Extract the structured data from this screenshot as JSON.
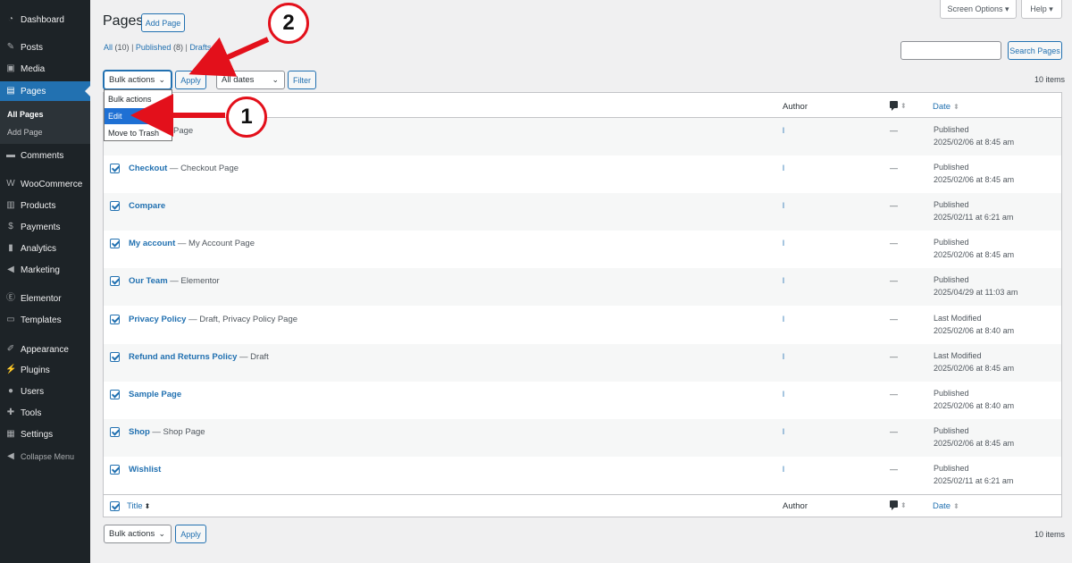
{
  "sidebar": {
    "items": [
      {
        "label": "Dashboard",
        "icon": "dashboard-icon"
      },
      {
        "label": "Posts",
        "icon": "pin-icon"
      },
      {
        "label": "Media",
        "icon": "media-icon"
      },
      {
        "label": "Pages",
        "icon": "page-icon"
      },
      {
        "label": "Comments",
        "icon": "comment-icon"
      },
      {
        "label": "WooCommerce",
        "icon": "woocommerce-icon"
      },
      {
        "label": "Products",
        "icon": "archive-icon"
      },
      {
        "label": "Payments",
        "icon": "dollar-icon"
      },
      {
        "label": "Analytics",
        "icon": "chart-icon"
      },
      {
        "label": "Marketing",
        "icon": "megaphone-icon"
      },
      {
        "label": "Elementor",
        "icon": "elementor-icon"
      },
      {
        "label": "Templates",
        "icon": "folder-icon"
      },
      {
        "label": "Appearance",
        "icon": "brush-icon"
      },
      {
        "label": "Plugins",
        "icon": "plug-icon"
      },
      {
        "label": "Users",
        "icon": "users-icon"
      },
      {
        "label": "Tools",
        "icon": "wrench-icon"
      },
      {
        "label": "Settings",
        "icon": "settings-icon"
      }
    ],
    "submenu": {
      "all_pages": "All Pages",
      "add_page": "Add Page"
    },
    "collapse": "Collapse Menu"
  },
  "top": {
    "screen_options": "Screen Options ▾",
    "help": "Help ▾"
  },
  "header": {
    "title": "Pages",
    "add_new": "Add Page"
  },
  "filters": {
    "all": "All",
    "all_count": "(10)",
    "published": "Published",
    "published_count": "(8)",
    "drafts": "Drafts",
    "drafts_count": "(2)",
    "bulk_actions": "Bulk actions",
    "apply": "Apply",
    "all_dates": "All dates",
    "filter": "Filter",
    "search_button": "Search Pages",
    "items_count": "10 items"
  },
  "dropdown": {
    "options": [
      "Bulk actions",
      "Edit",
      "Move to Trash"
    ],
    "selected": "Edit"
  },
  "table": {
    "columns": {
      "title": "Title",
      "author": "Author",
      "date": "Date"
    },
    "rows": [
      {
        "title": "",
        "state": "Page",
        "author": "l",
        "comments": "—",
        "status": "Published",
        "date": "2025/02/06 at 8:45 am"
      },
      {
        "title": "Checkout",
        "state": " — Checkout Page",
        "author": "l",
        "comments": "—",
        "status": "Published",
        "date": "2025/02/06 at 8:45 am"
      },
      {
        "title": "Compare",
        "state": "",
        "author": "l",
        "comments": "—",
        "status": "Published",
        "date": "2025/02/11 at 6:21 am"
      },
      {
        "title": "My account",
        "state": " — My Account Page",
        "author": "l",
        "comments": "—",
        "status": "Published",
        "date": "2025/02/06 at 8:45 am"
      },
      {
        "title": "Our Team",
        "state": " — Elementor",
        "author": "l",
        "comments": "—",
        "status": "Published",
        "date": "2025/04/29 at 11:03 am"
      },
      {
        "title": "Privacy Policy",
        "state": " — Draft, Privacy Policy Page",
        "author": "l",
        "comments": "—",
        "status": "Last Modified",
        "date": "2025/02/06 at 8:40 am"
      },
      {
        "title": "Refund and Returns Policy",
        "state": " — Draft",
        "author": "l",
        "comments": "—",
        "status": "Last Modified",
        "date": "2025/02/06 at 8:45 am"
      },
      {
        "title": "Sample Page",
        "state": "",
        "author": "l",
        "comments": "—",
        "status": "Published",
        "date": "2025/02/06 at 8:40 am"
      },
      {
        "title": "Shop",
        "state": " — Shop Page",
        "author": "l",
        "comments": "—",
        "status": "Published",
        "date": "2025/02/06 at 8:45 am"
      },
      {
        "title": "Wishlist",
        "state": "",
        "author": "l",
        "comments": "—",
        "status": "Published",
        "date": "2025/02/11 at 6:21 am"
      }
    ]
  },
  "bottom": {
    "bulk_actions": "Bulk actions",
    "apply": "Apply",
    "items_count": "10 items"
  },
  "callouts": {
    "one": "1",
    "two": "2"
  },
  "colors": {
    "accent": "#2271b1",
    "sidebar": "#1d2327",
    "callout": "#e3101b"
  }
}
